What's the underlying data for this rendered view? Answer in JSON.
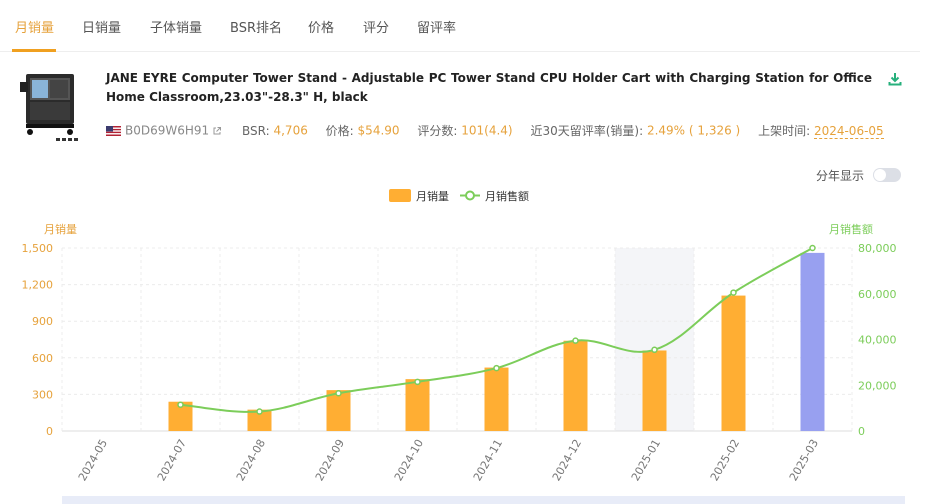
{
  "tabs": [
    {
      "label": "月销量",
      "active": true
    },
    {
      "label": "日销量",
      "active": false
    },
    {
      "label": "子体销量",
      "active": false
    },
    {
      "label": "BSR排名",
      "active": false
    },
    {
      "label": "价格",
      "active": false
    },
    {
      "label": "评分",
      "active": false
    },
    {
      "label": "留评率",
      "active": false
    }
  ],
  "product": {
    "title": "JANE EYRE Computer Tower Stand - Adjustable PC Tower Stand CPU Holder Cart with Charging Station for Office Home Classroom,23.03\"-28.3\" H, black",
    "asin": "B0D69W6H91",
    "bsr_label": "BSR:",
    "bsr_value": "4,706",
    "price_label": "价格:",
    "price_value": "$54.90",
    "rating_label": "评分数:",
    "rating_value": "101(4.4)",
    "review_rate_label": "近30天留评率(销量):",
    "review_rate_value": "2.49% ( 1,326 )",
    "listed_label": "上架时间:",
    "listed_value": "2024-06-05"
  },
  "controls": {
    "yearly_label": "分年显示",
    "yearly_on": false
  },
  "colors": {
    "accent": "#e6a23c",
    "bar": "#ffae33",
    "bar_highlight": "#98a0f0",
    "line": "#7ccd5a",
    "grid": "#ececec",
    "hover_band": "#f4f5f8"
  },
  "chart_data": {
    "type": "bar+line",
    "legend": [
      "月销量",
      "月销售额"
    ],
    "legend_position": "top-center",
    "y_left_label": "月销量",
    "y_right_label": "月销售额",
    "y_left_ticks": [
      "0",
      "300",
      "600",
      "900",
      "1,200",
      "1,500"
    ],
    "y_right_ticks": [
      "0",
      "20,000",
      "40,000",
      "60,000",
      "80,000"
    ],
    "y_left_range": [
      0,
      1500
    ],
    "y_right_range": [
      0,
      80000
    ],
    "categories": [
      "2024-05",
      "2024-07",
      "2024-08",
      "2024-09",
      "2024-10",
      "2024-11",
      "2024-12",
      "2025-01",
      "2025-02",
      "2025-03"
    ],
    "series": [
      {
        "name": "月销量",
        "kind": "bar",
        "values": [
          null,
          240,
          175,
          335,
          425,
          520,
          740,
          660,
          1110,
          1460
        ]
      },
      {
        "name": "月销售额",
        "kind": "line",
        "values": [
          null,
          11500,
          8500,
          16500,
          21500,
          27500,
          39500,
          35500,
          60500,
          80000
        ]
      }
    ],
    "highlighted_category": "2025-03",
    "hover_category": "2025-01"
  }
}
